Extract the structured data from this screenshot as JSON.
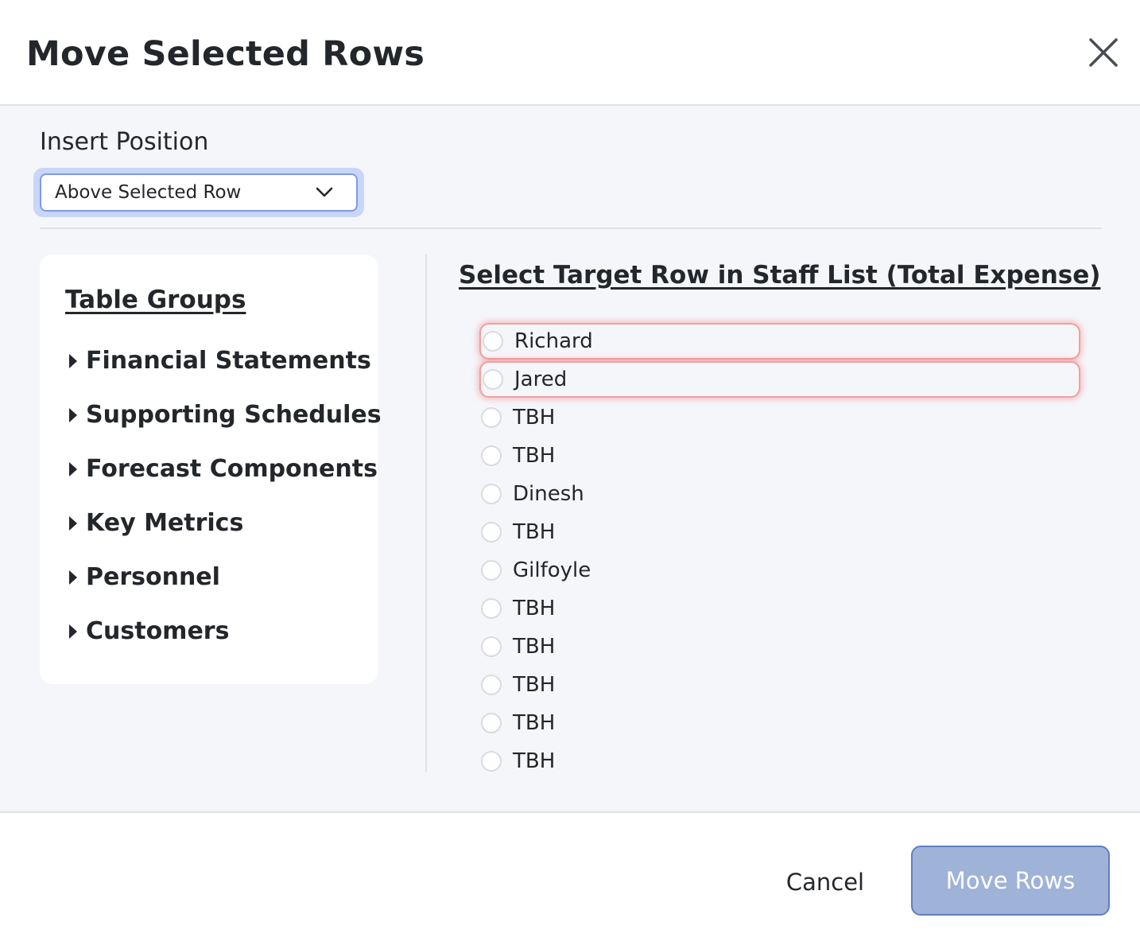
{
  "dialog": {
    "title": "Move Selected Rows"
  },
  "insert_position": {
    "label": "Insert Position",
    "selected": "Above Selected Row"
  },
  "groups": {
    "title": "Table Groups",
    "items": [
      {
        "label": "Financial Statements"
      },
      {
        "label": "Supporting Schedules"
      },
      {
        "label": "Forecast Components"
      },
      {
        "label": "Key Metrics"
      },
      {
        "label": "Personnel"
      },
      {
        "label": "Customers"
      }
    ]
  },
  "target": {
    "title": "Select Target Row in Staff List (Total Expense)",
    "rows": [
      {
        "label": "Richard",
        "state": "error"
      },
      {
        "label": "Jared",
        "state": "error"
      },
      {
        "label": "TBH",
        "state": "normal"
      },
      {
        "label": "TBH",
        "state": "normal"
      },
      {
        "label": "Dinesh",
        "state": "normal"
      },
      {
        "label": "TBH",
        "state": "normal"
      },
      {
        "label": "Gilfoyle",
        "state": "normal"
      },
      {
        "label": "TBH",
        "state": "normal"
      },
      {
        "label": "TBH",
        "state": "normal"
      },
      {
        "label": "TBH",
        "state": "normal"
      },
      {
        "label": "TBH",
        "state": "normal"
      },
      {
        "label": "TBH",
        "state": "normal"
      }
    ]
  },
  "footer": {
    "cancel_label": "Cancel",
    "submit_label": "Move Rows"
  },
  "colors": {
    "body_bg": "#f5f6fa",
    "primary_disabled": "#9fb3d9",
    "error_outline": "#f0a0a0"
  },
  "icons": {
    "close": "close-icon",
    "chevron": "chevron-down-icon",
    "caret": "caret-right-icon"
  }
}
